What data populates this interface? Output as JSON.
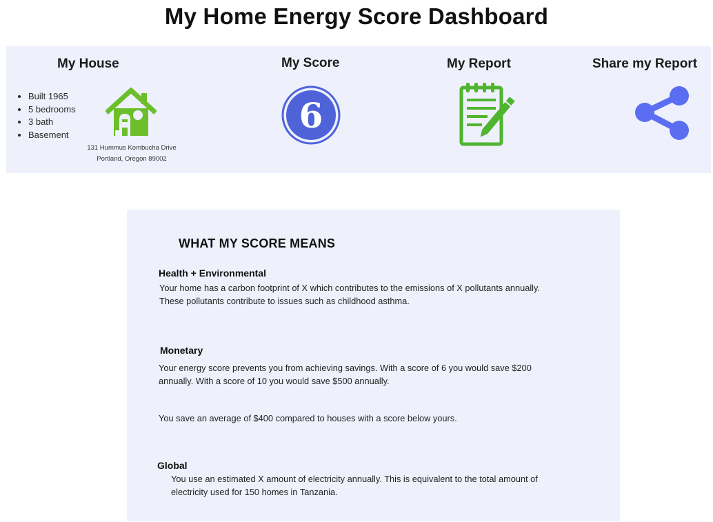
{
  "page": {
    "title": "My Home Energy Score Dashboard"
  },
  "house": {
    "title": "My House",
    "facts": [
      "Built 1965",
      "5 bedrooms",
      "3 bath",
      "Basement"
    ],
    "address_line1": "131 Hummus  Kombucha Drive",
    "address_line2": "Portland, Oregon 89002",
    "icon": "house-icon"
  },
  "score": {
    "title": "My Score",
    "value": "6",
    "icon": "score-badge"
  },
  "report": {
    "title": "My Report",
    "icon": "notepad-pencil-icon"
  },
  "share": {
    "title": "Share my Report",
    "icon": "share-icon"
  },
  "meaning": {
    "heading": "WHAT MY SCORE MEANS",
    "health": {
      "title": "Health + Environmental",
      "line1": "Your home has a carbon footprint of X which contributes to the emissions of X pollutants annually.",
      "line2": "These pollutants contribute to issues such as childhood asthma."
    },
    "monetary": {
      "title": "Monetary",
      "line1": "Your energy score prevents you from achieving savings. With a score of 6 you would save $200",
      "line2": "annually. With a score of 10 you would save $500 annually.",
      "savings": "You save an average of $400 compared to houses with a score below yours."
    },
    "global": {
      "title": "Global",
      "line1": "You use an estimated X amount of electricity annually. This is equivalent to the total amount of",
      "line2": "electricity used for 150 homes in Tanzania."
    }
  },
  "colors": {
    "panel_bg": "#eef0fc",
    "house_green": "#6cbf2a",
    "report_green": "#4fb52f",
    "score_blue": "#4f63d9",
    "share_blue": "#5b6df0"
  }
}
